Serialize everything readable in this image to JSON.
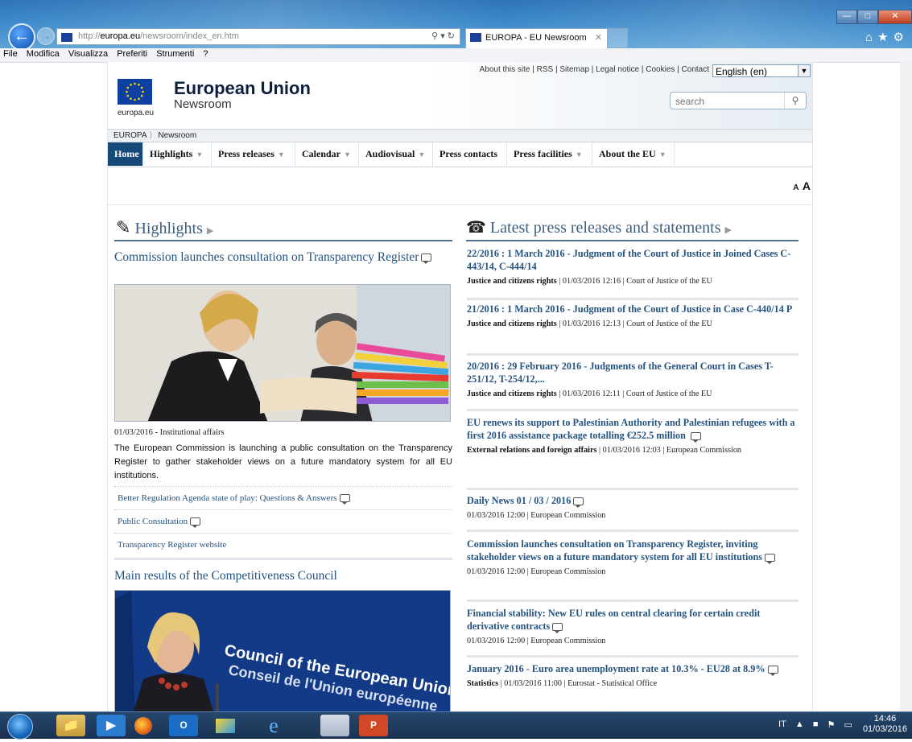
{
  "browser": {
    "address": {
      "scheme": "http://",
      "host": "europa.eu",
      "path": "/newsroom/index_en.htm"
    },
    "tab_title": "EUROPA - EU Newsroom",
    "menu": [
      "File",
      "Modifica",
      "Visualizza",
      "Preferiti",
      "Strumenti",
      "?"
    ]
  },
  "header": {
    "top_links": "About this site | RSS | Sitemap | Legal notice | Cookies | Contact",
    "language": "English (en)",
    "title": "European Union",
    "subtitle": "Newsroom",
    "logo_caption": "europa.eu",
    "search_placeholder": "search"
  },
  "breadcrumb": [
    "EUROPA",
    "Newsroom"
  ],
  "nav": [
    {
      "label": "Home"
    },
    {
      "label": "Highlights"
    },
    {
      "label": "Press releases"
    },
    {
      "label": "Calendar"
    },
    {
      "label": "Audiovisual"
    },
    {
      "label": "Press contacts"
    },
    {
      "label": "Press facilities"
    },
    {
      "label": "About the EU"
    }
  ],
  "font_size": {
    "small": "A",
    "large": "A"
  },
  "highlights": {
    "heading": "Highlights",
    "item1": {
      "title": "Commission launches consultation on Transparency Register",
      "meta": "01/03/2016 -  Institutional affairs",
      "abstract": "The European Commission is launching a public consultation on the Transparency Register to gather stakeholder views on a future mandatory system for all EU institutions.",
      "related": [
        "Better Regulation Agenda state of play: Questions & Answers",
        "Public Consultation",
        "Transparency Register website"
      ]
    },
    "item2": {
      "title": "Main results of the Competitiveness Council",
      "image_text_1": "Council of the European Union",
      "image_text_2": "Conseil de l'Union européenne"
    }
  },
  "press": {
    "heading": "Latest press releases and statements",
    "items": [
      {
        "title": "22/2016 : 1 March 2016 - Judgment of the Court of Justice in Joined Cases C-443/14, C-444/14",
        "cat": "Justice and citizens rights",
        "rest": " | 01/03/2016 12:16 | Court of Justice of the EU"
      },
      {
        "title": "21/2016 : 1 March 2016 - Judgment of the Court of Justice in Case C-440/14 P",
        "cat": "Justice and citizens rights",
        "rest": " | 01/03/2016 12:13 | Court of Justice of the EU"
      },
      {
        "title": "20/2016 : 29 February 2016 - Judgments of the General Court in Cases T-251/12, T-254/12,...",
        "cat": "Justice and citizens rights",
        "rest": " | 01/03/2016 12:11 | Court of Justice of the EU"
      },
      {
        "title": "EU renews its support to Palestinian Authority and Palestinian refugees with a first 2016 assistance package totalling €252.5 million",
        "cat": "External relations and foreign affairs",
        "rest": " | 01/03/2016 12:03 | European Commission"
      },
      {
        "title": "Daily News 01 / 03 / 2016",
        "cat": "",
        "rest": "01/03/2016 12:00 | European Commission"
      },
      {
        "title": "Commission launches consultation on Transparency Register, inviting stakeholder views on a future mandatory system for all EU institutions",
        "cat": "",
        "rest": "01/03/2016 12:00 | European Commission"
      },
      {
        "title": "Financial stability: New EU rules on central clearing for certain credit derivative contracts",
        "cat": "",
        "rest": "01/03/2016 12:00 | European Commission"
      },
      {
        "title": "January 2016 - Euro area unemployment rate at 10.3% - EU28 at 8.9%",
        "cat": "Statistics",
        "rest": " | 01/03/2016 11:00 | Eurostat - Statistical Office"
      }
    ]
  },
  "taskbar": {
    "lang": "IT",
    "time": "14:46",
    "date": "01/03/2016"
  },
  "colors": {
    "nav_home_bg": "#174a79",
    "link": "#25537f",
    "heading": "#3f5f7e"
  }
}
